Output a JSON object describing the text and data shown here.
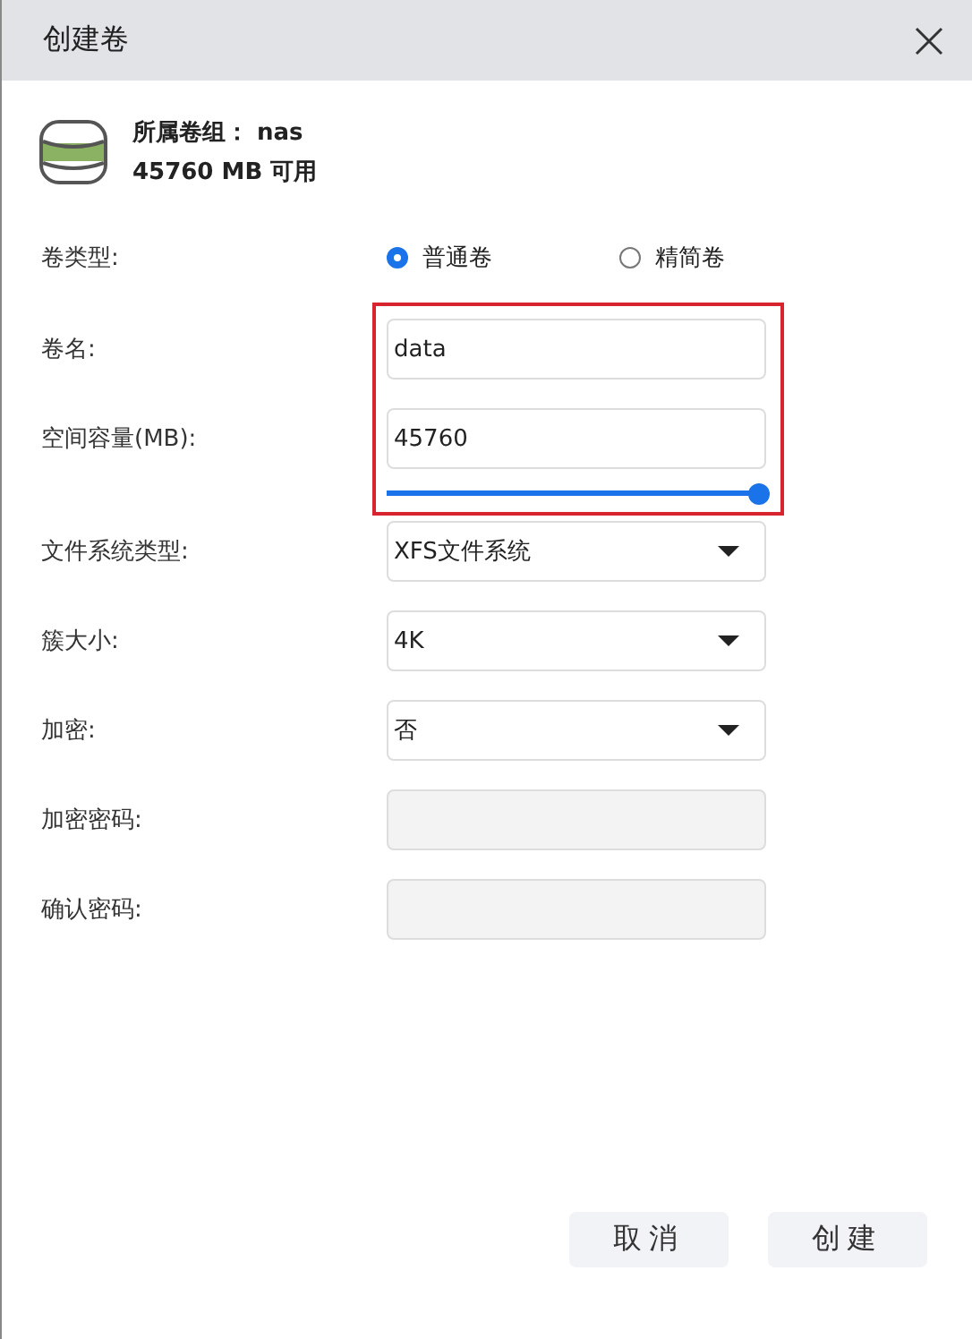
{
  "title": "创建卷",
  "volume_group": {
    "label": "所属卷组：",
    "name": "nas",
    "free": "45760 MB 可用"
  },
  "volume_type": {
    "label": "卷类型:",
    "options": [
      {
        "label": "普通卷",
        "selected": true
      },
      {
        "label": "精简卷",
        "selected": false
      }
    ]
  },
  "name": {
    "label": "卷名:",
    "value": "data"
  },
  "capacity": {
    "label": "空间容量(MB):",
    "value": "45760",
    "level": 1
  },
  "selects": [
    {
      "label": "文件系统类型:",
      "value": "XFS文件系统"
    },
    {
      "label": "簇大小:",
      "value": "4K"
    },
    {
      "label": "加密:",
      "value": "否"
    }
  ],
  "passwords": [
    {
      "label": "加密密码:",
      "disabled": true
    },
    {
      "label": "确认密码:",
      "disabled": true
    }
  ],
  "buttons": [
    "取消",
    "创建"
  ]
}
